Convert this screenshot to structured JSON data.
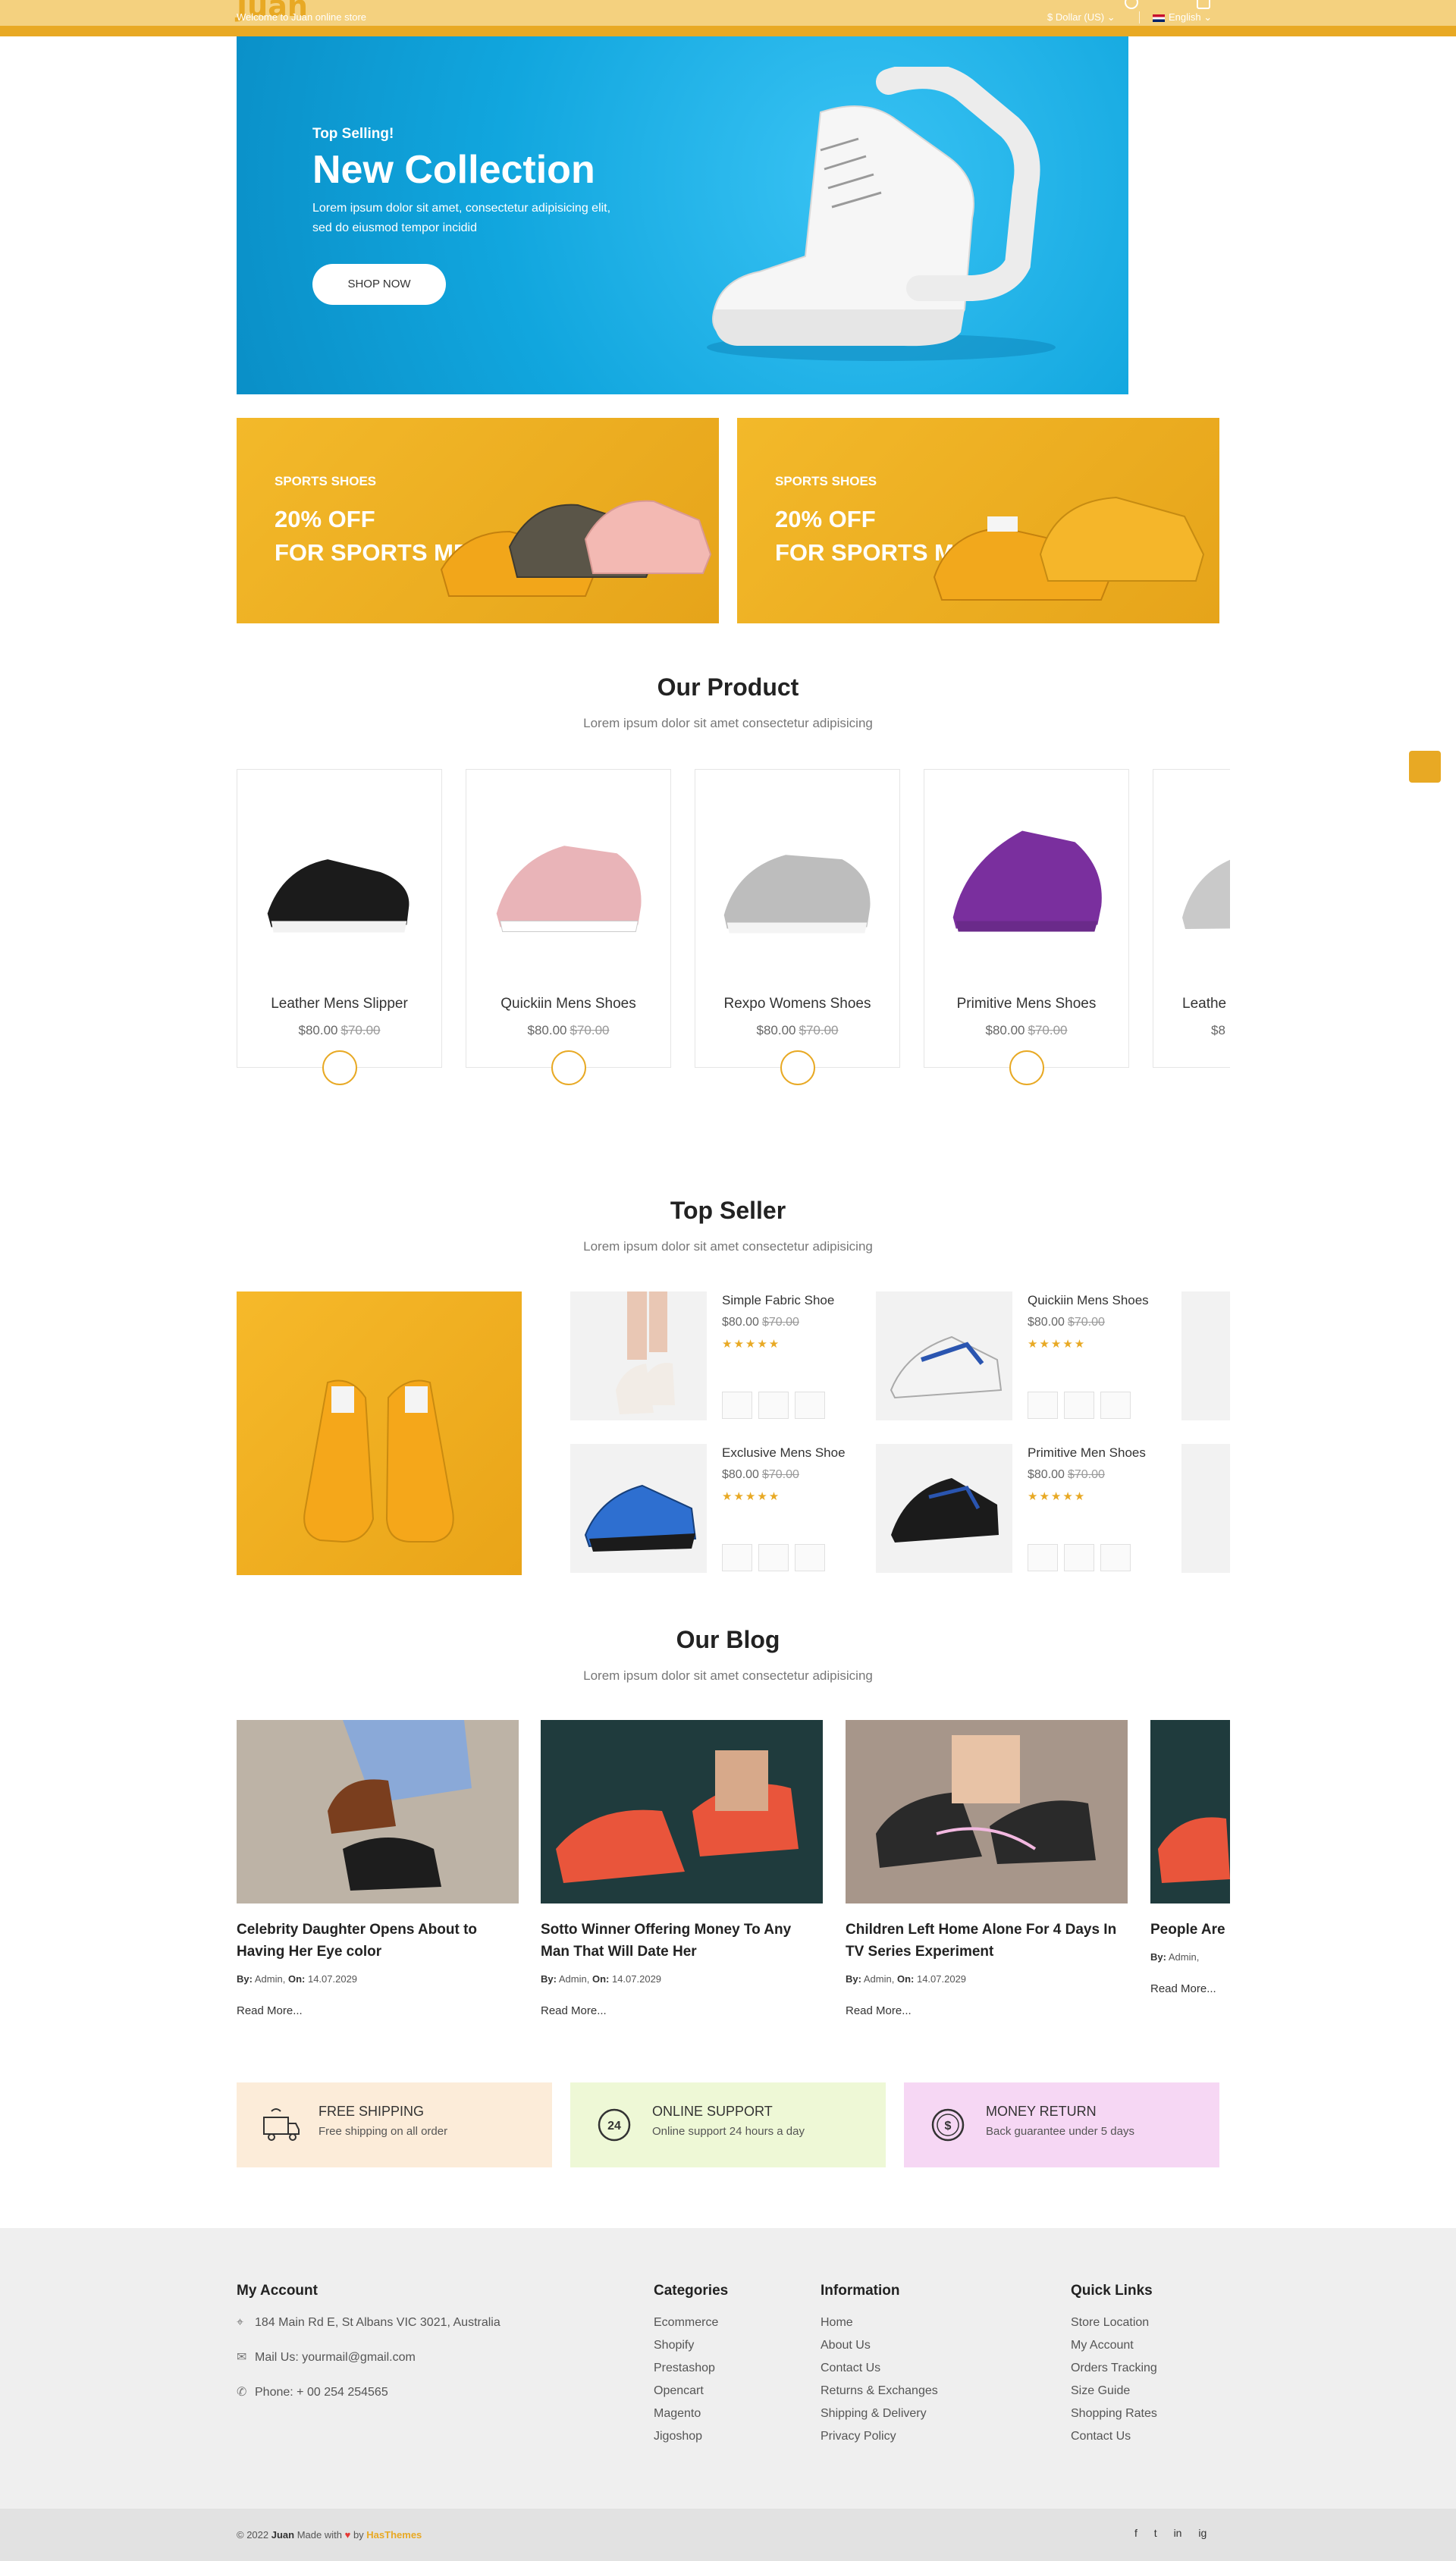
{
  "header": {
    "logo": "Juan",
    "welcome": "Welcome to Juan online store",
    "currency": "$ Dollar (US) ⌄",
    "language": "English ⌄"
  },
  "hero": {
    "kicker": "Top Selling!",
    "title": "New Collection",
    "description": "Lorem ipsum dolor sit amet, consectetur adipisicing elit, sed do eiusmod tempor incidid",
    "button": "SHOP NOW"
  },
  "promos": [
    {
      "tag": "SPORTS SHOES",
      "line1": "20% OFF",
      "line2": "FOR SPORTS MEN"
    },
    {
      "tag": "SPORTS SHOES",
      "line1": "20% OFF",
      "line2": "FOR SPORTS MEN"
    }
  ],
  "our_product": {
    "title": "Our Product",
    "subtitle": "Lorem ipsum dolor sit amet consectetur adipisicing",
    "items": [
      {
        "name": "Leather Mens Slipper",
        "price": "$80.00",
        "old_price": "$70.00",
        "color": "#1b1b1b"
      },
      {
        "name": "Quickiin Mens Shoes",
        "price": "$80.00",
        "old_price": "$70.00",
        "color": "#e9b4b8"
      },
      {
        "name": "Rexpo Womens Shoes",
        "price": "$80.00",
        "old_price": "$70.00",
        "color": "#bdbdbd"
      },
      {
        "name": "Primitive Mens Shoes",
        "price": "$80.00",
        "old_price": "$70.00",
        "color": "#7a2f9e"
      },
      {
        "name": "Leathe",
        "price": "$8",
        "old_price": "",
        "color": "#c9c9c9"
      }
    ]
  },
  "top_seller": {
    "title": "Top Seller",
    "subtitle": "Lorem ipsum dolor sit amet consectetur adipisicing",
    "items": [
      {
        "name": "Simple Fabric Shoe",
        "price": "$80.00",
        "old_price": "$70.00",
        "stars": "★★★★★"
      },
      {
        "name": "Quickiin Mens Shoes",
        "price": "$80.00",
        "old_price": "$70.00",
        "stars": "★★★★★"
      },
      {
        "name": "Exclusive Mens Shoe",
        "price": "$80.00",
        "old_price": "$70.00",
        "stars": "★★★★★"
      },
      {
        "name": "Primitive Men Shoes",
        "price": "$80.00",
        "old_price": "$70.00",
        "stars": "★★★★★"
      }
    ]
  },
  "blog": {
    "title": "Our Blog",
    "subtitle": "Lorem ipsum dolor sit amet consectetur adipisicing",
    "posts": [
      {
        "title": "Celebrity Daughter Opens About to Having Her Eye color",
        "by_label": "By:",
        "author": "Admin,",
        "on_label": "On:",
        "date": "14.07.2029",
        "more": "Read More..."
      },
      {
        "title": "Sotto Winner Offering Money To Any Man That Will Date Her",
        "by_label": "By:",
        "author": "Admin,",
        "on_label": "On:",
        "date": "14.07.2029",
        "more": "Read More..."
      },
      {
        "title": "Children Left Home Alone For 4 Days In TV Series Experiment",
        "by_label": "By:",
        "author": "Admin,",
        "on_label": "On:",
        "date": "14.07.2029",
        "more": "Read More..."
      },
      {
        "title": "People Are Money Rese",
        "by_label": "By:",
        "author": "Admin,",
        "on_label": "",
        "date": "",
        "more": "Read More..."
      }
    ]
  },
  "features": [
    {
      "title": "FREE SHIPPING",
      "text": "Free shipping on all order",
      "bg": "#fcecd9",
      "icon": "free-truck-icon"
    },
    {
      "title": "ONLINE SUPPORT",
      "text": "Online support 24 hours a day",
      "bg": "#eef8d6",
      "icon": "support-24-icon"
    },
    {
      "title": "MONEY RETURN",
      "text": "Back guarantee under 5 days",
      "bg": "#f6d7f4",
      "icon": "money-return-icon"
    }
  ],
  "footer": {
    "my_account": {
      "title": "My Account",
      "address": "184 Main Rd E, St Albans VIC 3021, Australia",
      "mail": "Mail Us: yourmail@gmail.com",
      "phone": "Phone: + 00 254 254565"
    },
    "categories": {
      "title": "Categories",
      "items": [
        "Ecommerce",
        "Shopify",
        "Prestashop",
        "Opencart",
        "Magento",
        "Jigoshop"
      ]
    },
    "information": {
      "title": "Information",
      "items": [
        "Home",
        "About Us",
        "Contact Us",
        "Returns & Exchanges",
        "Shipping & Delivery",
        "Privacy Policy"
      ]
    },
    "quick_links": {
      "title": "Quick Links",
      "items": [
        "Store Location",
        "My Account",
        "Orders Tracking",
        "Size Guide",
        "Shopping Rates",
        "Contact Us"
      ]
    }
  },
  "copyright": {
    "prefix": "© 2022",
    "brand": "Juan",
    "middle": "Made with",
    "heart": "♥",
    "by": "by",
    "company": "HasThemes"
  },
  "socials": [
    "f",
    "t",
    "in",
    "ig"
  ]
}
